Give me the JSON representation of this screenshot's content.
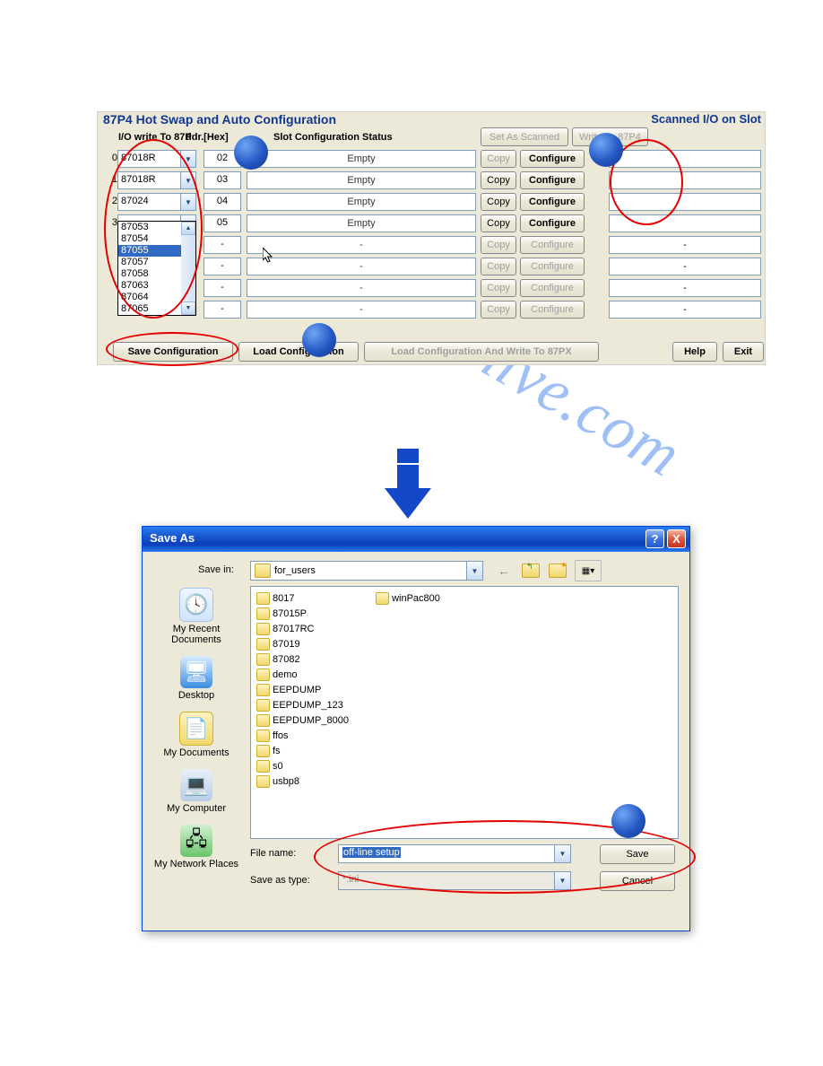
{
  "top": {
    "title": "87P4 Hot Swap and Auto Configuration",
    "scanned_title": "Scanned I/O on Slot",
    "hdr_io": "I/O write To 87P",
    "hdr_addr": "ddr.[Hex]",
    "hdr_slot": "Slot Configuration Status",
    "btn_set_scanned": "Set As Scanned",
    "btn_write_87p4": "Write To 87P4",
    "btn_copy": "Copy",
    "btn_configure": "Configure",
    "rows": [
      {
        "n": "0",
        "io": "87018R",
        "addr": "02",
        "status": "Empty",
        "copy_disabled": true,
        "conf_bold": true,
        "scan": ""
      },
      {
        "n": "1",
        "io": "87018R",
        "addr": "03",
        "status": "Empty",
        "copy_disabled": false,
        "conf_bold": true,
        "scan": ""
      },
      {
        "n": "2",
        "io": "87024",
        "addr": "04",
        "status": "Empty",
        "copy_disabled": false,
        "conf_bold": true,
        "scan": ""
      },
      {
        "n": "3",
        "io": "",
        "addr": "05",
        "status": "Empty",
        "copy_disabled": false,
        "conf_bold": true,
        "scan": ""
      },
      {
        "n": "",
        "io": "",
        "addr": "-",
        "status": "-",
        "copy_disabled": true,
        "conf_bold": false,
        "scan": "-"
      },
      {
        "n": "",
        "io": "",
        "addr": "-",
        "status": "-",
        "copy_disabled": true,
        "conf_bold": false,
        "scan": "-"
      },
      {
        "n": "",
        "io": "",
        "addr": "-",
        "status": "-",
        "copy_disabled": true,
        "conf_bold": false,
        "scan": "-"
      },
      {
        "n": "",
        "io": "",
        "addr": "-",
        "status": "-",
        "copy_disabled": true,
        "conf_bold": false,
        "scan": "-"
      }
    ],
    "dropdown_items": [
      "87053",
      "87054",
      "87055",
      "87057",
      "87058",
      "87063",
      "87064",
      "87065"
    ],
    "dropdown_selected": "87055",
    "bottom": {
      "save": "Save Configuration",
      "load": "Load Configuration",
      "load_write": "Load  Configuration And Write To 87PX",
      "help": "Help",
      "exit": "Exit"
    }
  },
  "dlg": {
    "title": "Save As",
    "savein_label": "Save in:",
    "savein_value": "for_users",
    "places": [
      {
        "label": "My Recent Documents"
      },
      {
        "label": "Desktop"
      },
      {
        "label": "My Documents"
      },
      {
        "label": "My Computer"
      },
      {
        "label": "My Network Places"
      }
    ],
    "files_col1": [
      "8017",
      "87015P",
      "87017RC",
      "87019",
      "87082",
      "demo",
      "EEPDUMP",
      "EEPDUMP_123",
      "EEPDUMP_8000",
      "ffos",
      "fs",
      "s0",
      "usbp8"
    ],
    "files_col2": [
      "winPac800"
    ],
    "filename_label": "File name:",
    "filename_value": "off-line setup",
    "savetype_label": "Save as type:",
    "savetype_value": "*.ini",
    "btn_save": "Save",
    "btn_cancel": "Cancel"
  }
}
